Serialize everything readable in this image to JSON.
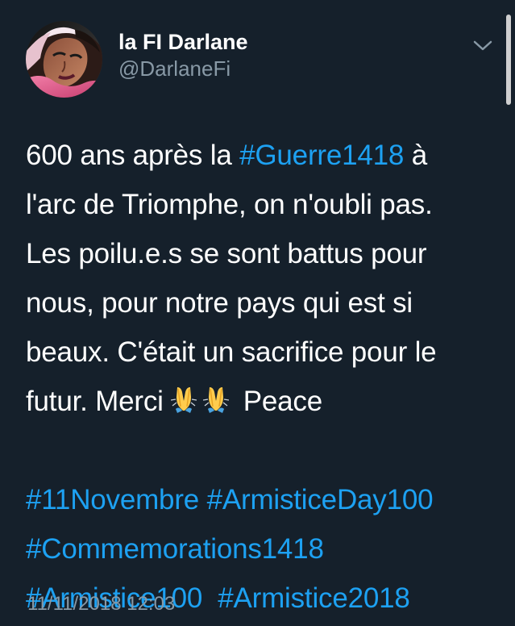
{
  "tweet": {
    "author": {
      "display_name": "la FI Darlane",
      "handle": "@DarlaneFi"
    },
    "body": {
      "line1_prefix": "600 ans après la ",
      "line1_hashtag": "#Guerre1418",
      "line1_suffix": " à",
      "line2": "l'arc de Triomphe, on n'oubli pas.",
      "line3": "Les poilu.e.s se sont battus pour",
      "line4": "nous, pour notre pays qui est si",
      "line5": "beaux. C'était un sacrifice pour le",
      "line6_prefix": "futur. Merci ",
      "line6_suffix": " Peace",
      "emoji_name": "folded-hands-emoji"
    },
    "hashtags": {
      "tag1": "#11Novembre",
      "tag2": "#ArmisticeDay100",
      "tag3": "#Commemorations1418",
      "tag4": "#Armistice100",
      "tag5": "#Armistice2018"
    },
    "timestamp": "11/11/2018 12:03",
    "menu_icon": "chevron-down-icon"
  },
  "colors": {
    "background": "#15202b",
    "text": "#ffffff",
    "muted": "#8899a6",
    "link": "#1da1f2"
  }
}
